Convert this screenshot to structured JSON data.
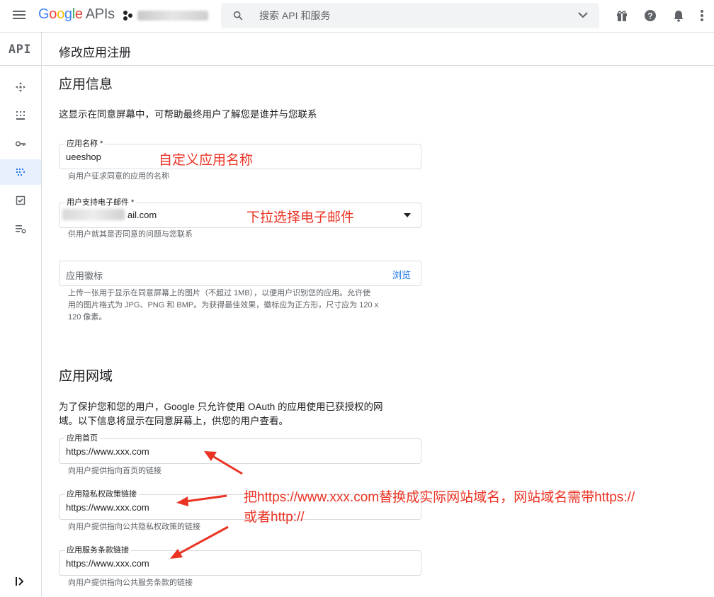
{
  "topbar": {
    "logo_letters": [
      "G",
      "o",
      "o",
      "g",
      "l",
      "e"
    ],
    "logo_product": "APIs",
    "search_placeholder": "搜索 API 和服务"
  },
  "rail": {
    "api_label": "API",
    "items": [
      {
        "icon": "diamond-arrows-icon"
      },
      {
        "icon": "grid-library-icon"
      },
      {
        "icon": "key-icon"
      },
      {
        "icon": "oauth-consent-icon",
        "active": true
      },
      {
        "icon": "checkbox-icon"
      },
      {
        "icon": "settings-list-icon"
      }
    ]
  },
  "page": {
    "title": "修改应用注册"
  },
  "app_info": {
    "title": "应用信息",
    "description": "这显示在同意屏幕中，可帮助最终用户了解您是谁并与您联系",
    "app_name": {
      "label": "应用名称 *",
      "value": "ueeshop",
      "helper": "向用户征求同意的应用的名称"
    },
    "support_email": {
      "label": "用户支持电子邮件 *",
      "value_visible": "ail.com",
      "helper": "供用户就其是否同意的问题与您联系"
    },
    "logo": {
      "placeholder": "应用徽标",
      "browse": "浏览",
      "helper_lines": [
        "上传一张用于显示在同意屏幕上的图片（不超过 1MB），以便用户识别您的应用。允许使",
        "用的图片格式为 JPG、PNG 和 BMP。为获得最佳效果，徽标应为正方形，尺寸应为 120 x",
        "120 像素。"
      ]
    }
  },
  "app_domain": {
    "title": "应用网域",
    "description_lines": [
      "为了保护您和您的用户，Google 只允许使用 OAuth 的应用使用已获授权的网",
      "域。以下信息将显示在同意屏幕上，供您的用户查看。"
    ],
    "homepage": {
      "label": "应用首页",
      "value": "https://www.xxx.com",
      "helper": "向用户提供指向首页的链接"
    },
    "privacy": {
      "label": "应用隐私权政策链接",
      "value": "https://www.xxx.com",
      "helper": "向用户提供指向公共隐私权政策的链接"
    },
    "terms": {
      "label": "应用服务条款链接",
      "value": "https://www.xxx.com",
      "helper": "向用户提供指向公共服务条款的链接"
    }
  },
  "annotations": {
    "app_name": "自定义应用名称",
    "email": "下拉选择电子邮件",
    "domain_line1": "把https://www.xxx.com替换成实际网站域名，网站域名需带https://",
    "domain_line2": "或者http://"
  },
  "colors": {
    "accent_blue": "#1a73e8",
    "annotation_red": "#ea3323",
    "active_rail_bg": "#e8f0fe"
  }
}
